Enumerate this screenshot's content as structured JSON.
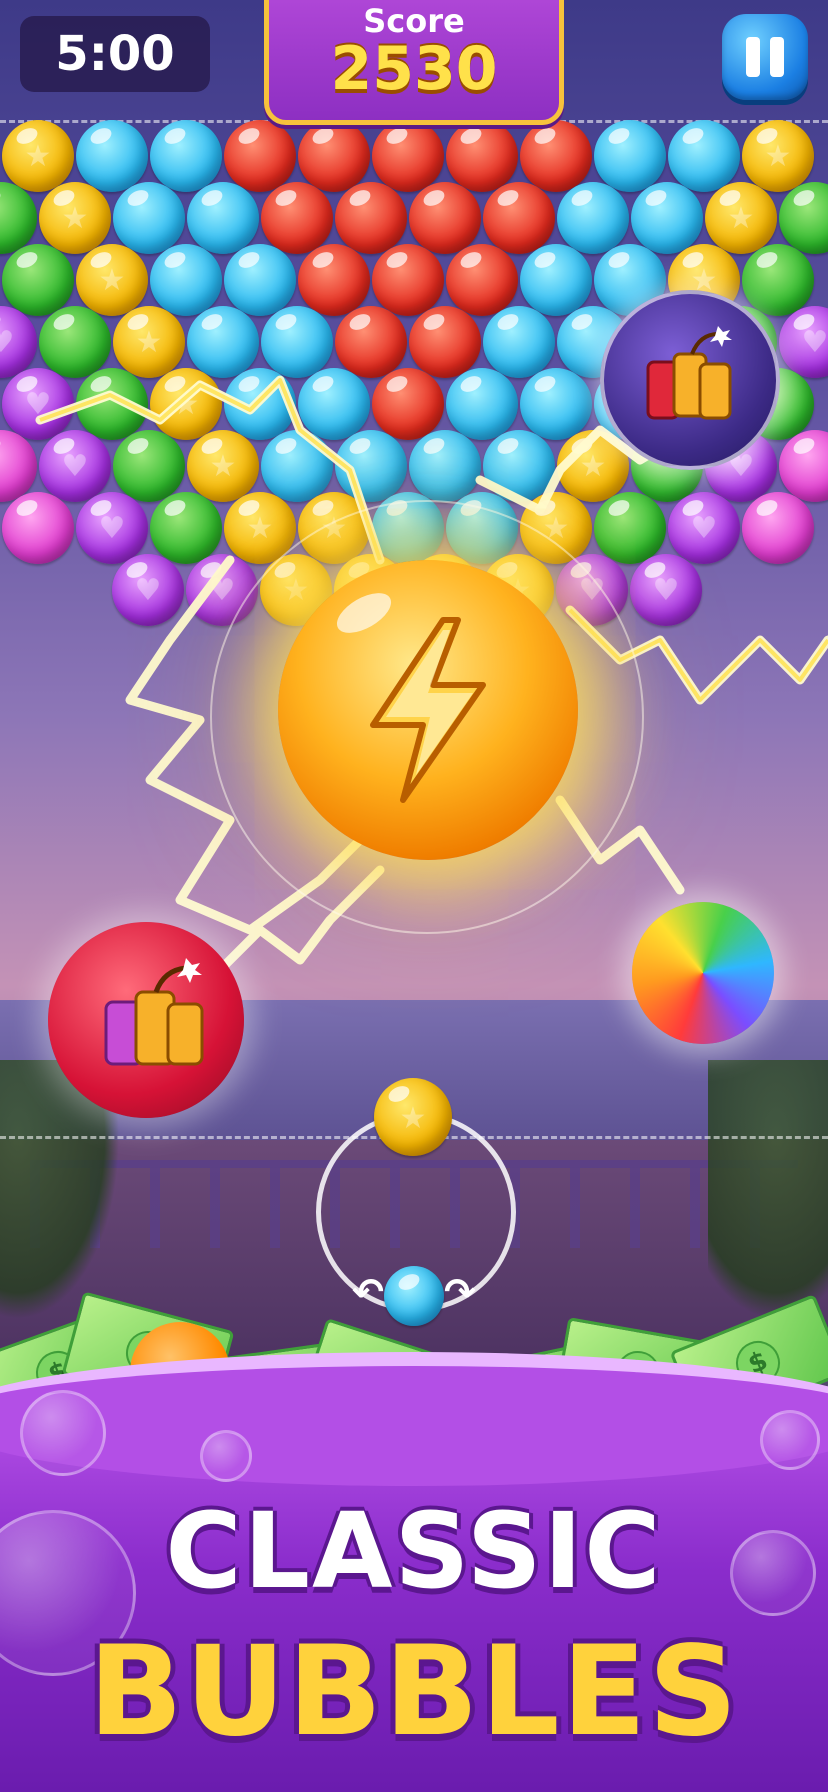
{
  "hud": {
    "timer": "5:00",
    "score_label": "Score",
    "score_value": "2530"
  },
  "banner": {
    "line1": "CLASSIC",
    "line2": "BUBBLES"
  },
  "colors": {
    "yellow": "#f4b400",
    "blue": "#29b8f0",
    "red": "#e32a1e",
    "green": "#2cb72a",
    "purple": "#a42fe0",
    "pink": "#e03ccf",
    "accent_gold": "#ffd23c",
    "panel_purple": "#8d2fc2"
  },
  "icons": {
    "pause": "pause-icon",
    "lightning": "lightning-bolt-icon",
    "bomb": "tnt-bomb-icon",
    "rainbow": "rainbow-ball-icon",
    "swap": "swap-arrows-icon",
    "cash": "dollar-bill-icon"
  },
  "board": {
    "rows": [
      [
        "yellow",
        "blue",
        "blue",
        "red",
        "red",
        "red",
        "red",
        "red",
        "blue",
        "blue",
        "yellow"
      ],
      [
        "green",
        "yellow",
        "blue",
        "blue",
        "red",
        "red",
        "red",
        "red",
        "blue",
        "blue",
        "yellow",
        "green"
      ],
      [
        "green",
        "yellow",
        "blue",
        "blue",
        "red",
        "red",
        "red",
        "blue",
        "blue",
        "yellow",
        "green"
      ],
      [
        "purple",
        "green",
        "yellow",
        "blue",
        "blue",
        "red",
        "red",
        "blue",
        "blue",
        "yellow",
        "green",
        "purple"
      ],
      [
        "purple",
        "green",
        "yellow",
        "blue",
        "blue",
        "red",
        "blue",
        "blue",
        "blue",
        "yellow",
        "green"
      ],
      [
        "pink",
        "purple",
        "green",
        "yellow",
        "blue",
        "blue",
        "blue",
        "blue",
        "yellow",
        "green",
        "purple",
        "pink"
      ],
      [
        "pink",
        "purple",
        "green",
        "yellow",
        "yellow",
        "blue",
        "blue",
        "yellow",
        "green",
        "purple",
        "pink"
      ],
      [
        "purple",
        "purple",
        "yellow",
        "yellow",
        "yellow",
        "yellow",
        "purple",
        "purple"
      ]
    ]
  },
  "shooter": {
    "current": "yellow",
    "next": "blue"
  },
  "loose": [
    "orange",
    "purple"
  ]
}
